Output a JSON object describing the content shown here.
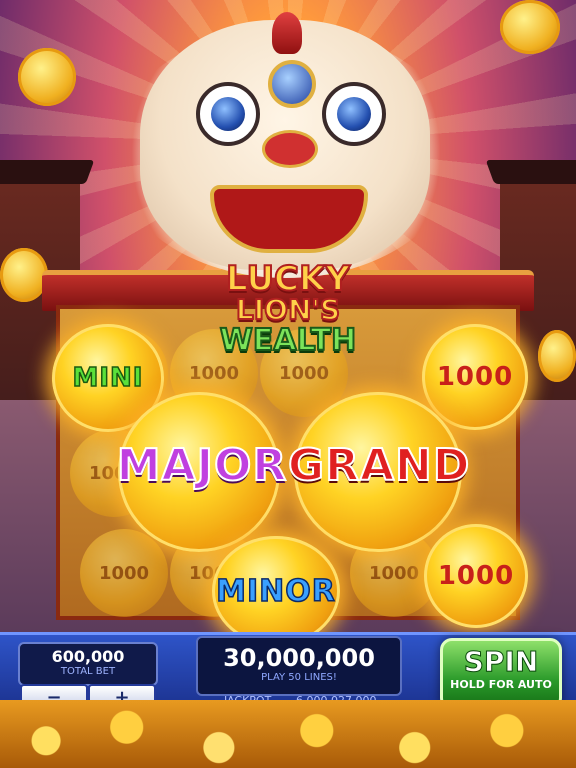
{
  "game": {
    "title_line1": "LUCKY",
    "title_line2": "LION'S",
    "title_line3": "WEALTH"
  },
  "jackpots": {
    "mini": "MINI",
    "major": "MAJOR",
    "grand": "GRAND",
    "minor": "MINOR"
  },
  "reel_symbols": [
    "1000",
    "1000",
    "1000",
    "1000",
    "1000",
    "1000",
    "1000"
  ],
  "coin_values": {
    "right_top": "1000",
    "right_bottom": "1000"
  },
  "controls": {
    "bet_value": "600,000",
    "bet_label": "TOTAL BET",
    "minus_label": "−",
    "plus_label": "+",
    "win_value": "30,000,000",
    "lines_label": "PLAY 50 LINES!",
    "jackpot_label": "JACKPOT",
    "jackpot_value": "6,000,027,000",
    "spin_label": "SPIN",
    "spin_sub": "HOLD FOR AUTO"
  },
  "colors": {
    "mini": "#5be03a",
    "major": "#c040e0",
    "grand": "#e02020",
    "minor": "#3aa0ff",
    "coin_text": "#c8201a"
  }
}
